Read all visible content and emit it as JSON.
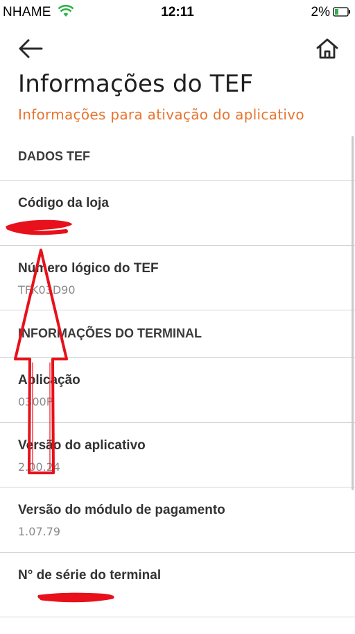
{
  "status_bar": {
    "carrier": "NHAME",
    "time": "12:11",
    "battery_percent": "2%",
    "battery_level": 0.02
  },
  "nav": {
    "back_icon": "arrow-left-icon",
    "home_icon": "home-icon"
  },
  "header": {
    "title": "Informações do TEF",
    "subtitle": "Informações para ativação do aplicativo"
  },
  "sections": [
    {
      "title": "DADOS TEF",
      "rows": [
        {
          "label": "Código da loja",
          "value": ""
        },
        {
          "label": "Número lógico do TEF",
          "value": "TFK03D90"
        }
      ]
    },
    {
      "title": "INFORMAÇÕES DO TERMINAL",
      "rows": [
        {
          "label": "Aplicação",
          "value": "0300P"
        },
        {
          "label": "Versão do aplicativo",
          "value": "2.00.24"
        },
        {
          "label": "Versão do módulo de pagamento",
          "value": "1.07.79"
        },
        {
          "label": "N° de série do terminal",
          "value": ""
        }
      ]
    }
  ],
  "colors": {
    "accent": "#e8742e",
    "annotation": "#e8101a"
  }
}
